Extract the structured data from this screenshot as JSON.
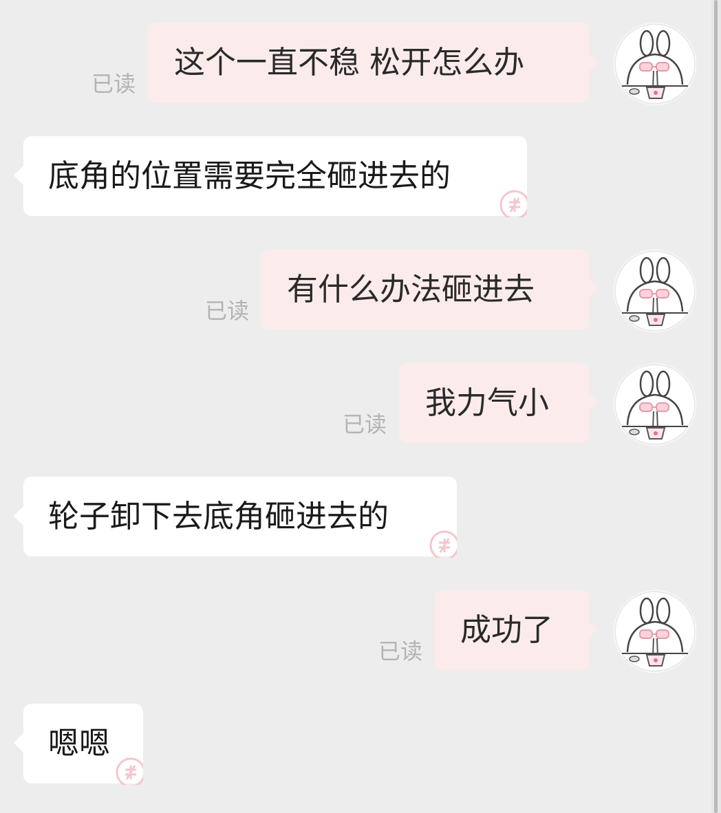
{
  "read_label": "已读",
  "messages": [
    {
      "side": "sent",
      "text": "这个一直不稳 松开怎么办",
      "read": true
    },
    {
      "side": "received",
      "text": "底角的位置需要完全砸进去的"
    },
    {
      "side": "sent",
      "text": "有什么办法砸进去",
      "read": true
    },
    {
      "side": "sent",
      "text": "我力气小",
      "read": true
    },
    {
      "side": "received",
      "text": "轮子卸下去底角砸进去的"
    },
    {
      "side": "sent",
      "text": "成功了",
      "read": true
    },
    {
      "side": "received",
      "text": "嗯嗯"
    }
  ],
  "icons": {
    "own_avatar": "bunny-eating-noodles-avatar-icon",
    "received_stamp": "pink-stamp-icon"
  },
  "colors": {
    "background": "#ededed",
    "sent_bubble": "#fbeceb",
    "received_bubble": "#ffffff",
    "read_text": "#b3b3b3"
  }
}
